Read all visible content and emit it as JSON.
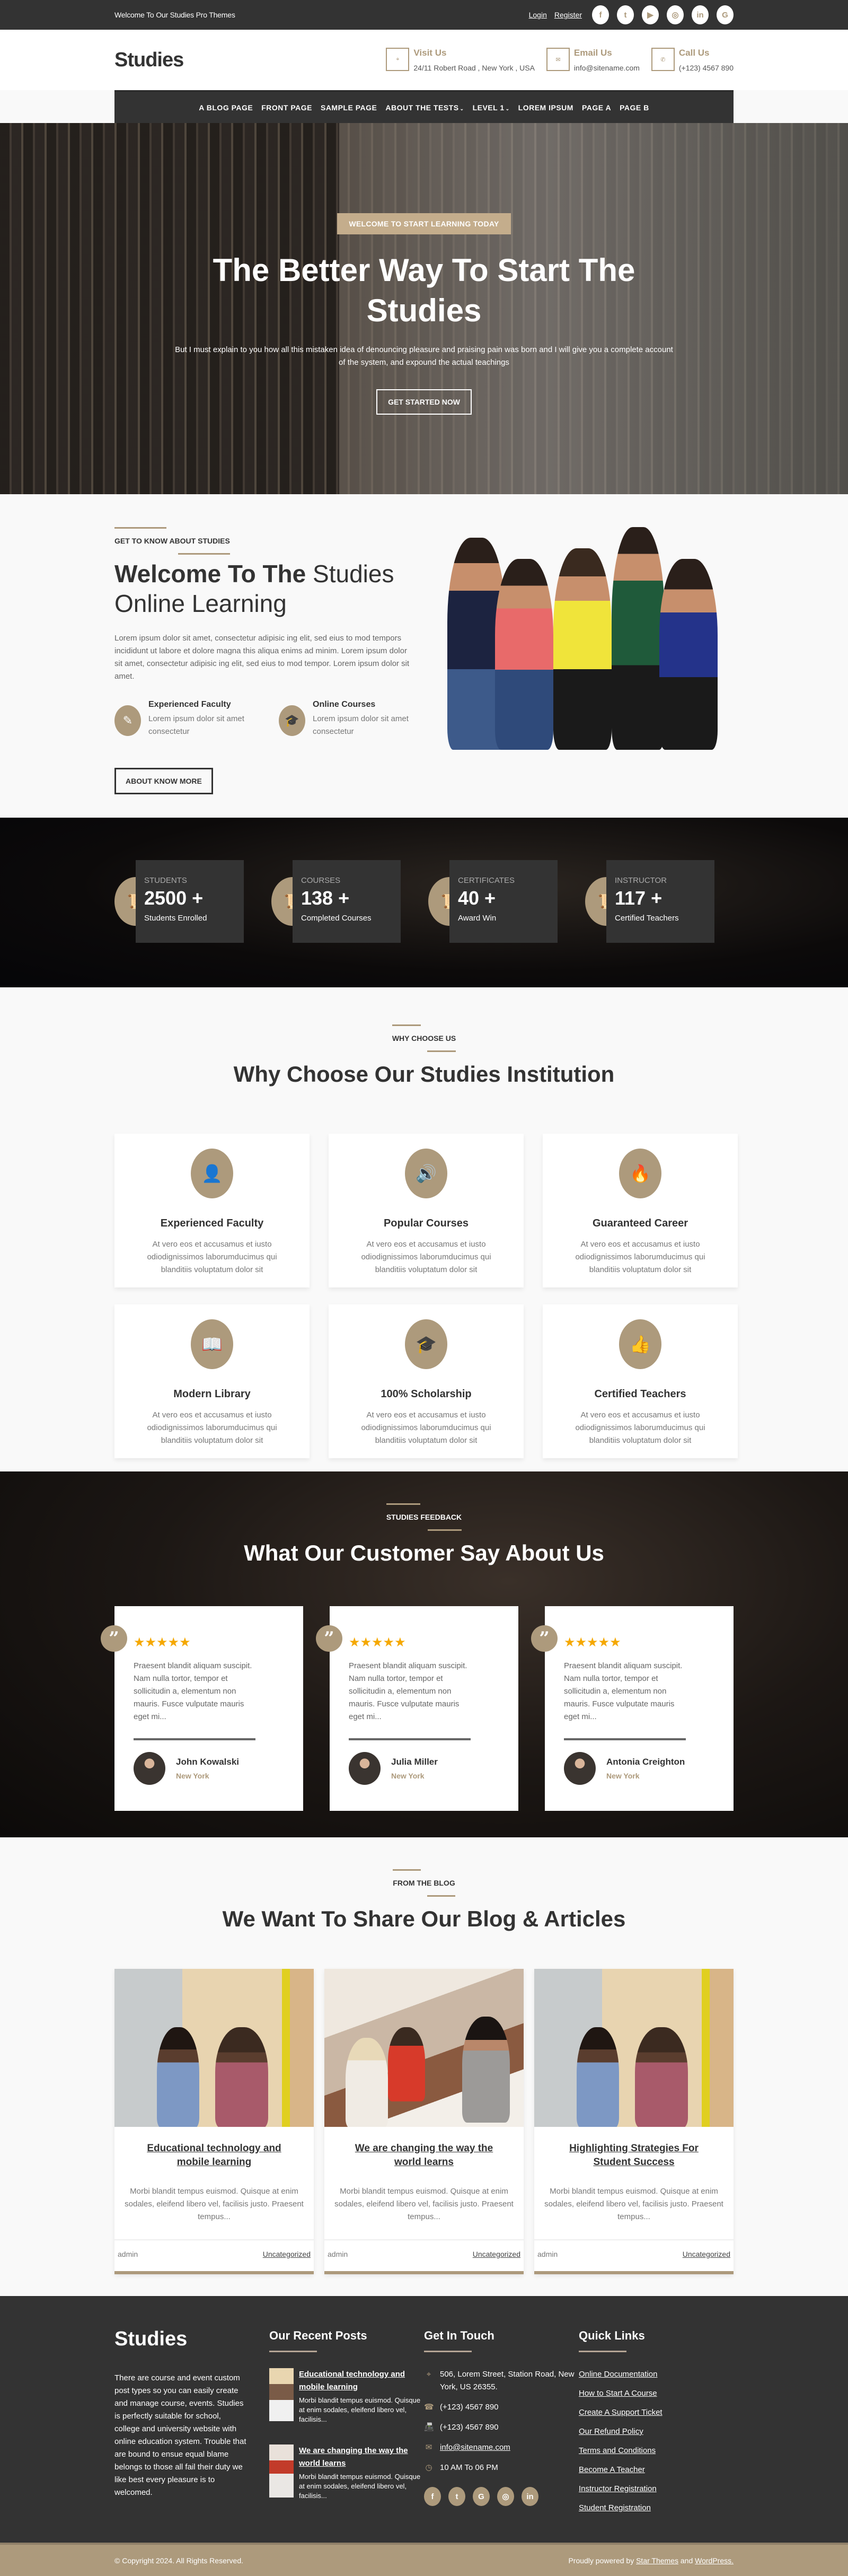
{
  "topbar": {
    "welcome": "Welcome To Our Studies Pro Themes",
    "login": "Login",
    "register": "Register",
    "social": [
      {
        "icon": "facebook-icon",
        "glyph": "f"
      },
      {
        "icon": "twitter-icon",
        "glyph": "t"
      },
      {
        "icon": "youtube-icon",
        "glyph": "▶"
      },
      {
        "icon": "instagram-icon",
        "glyph": "◎"
      },
      {
        "icon": "linkedin-icon",
        "glyph": "in"
      },
      {
        "icon": "google-icon",
        "glyph": "G"
      }
    ]
  },
  "header": {
    "logo": "Studies",
    "contacts": [
      {
        "icon": "map-pin-icon",
        "glyph": "⌖",
        "title": "Visit Us",
        "value": "24/11 Robert Road , New York , USA"
      },
      {
        "icon": "envelope-icon",
        "glyph": "✉",
        "title": "Email Us",
        "value": "info@sitename.com"
      },
      {
        "icon": "phone-icon",
        "glyph": "✆",
        "title": "Call Us",
        "value": "(+123) 4567 890"
      }
    ]
  },
  "nav": {
    "items": [
      {
        "label": "A BLOG PAGE",
        "dropdown": false
      },
      {
        "label": "FRONT PAGE",
        "dropdown": false
      },
      {
        "label": "SAMPLE PAGE",
        "dropdown": false
      },
      {
        "label": "ABOUT THE TESTS",
        "dropdown": true
      },
      {
        "label": "LEVEL 1",
        "dropdown": true
      },
      {
        "label": "LOREM IPSUM",
        "dropdown": false
      },
      {
        "label": "PAGE A",
        "dropdown": false
      },
      {
        "label": "PAGE B",
        "dropdown": false
      }
    ]
  },
  "hero": {
    "badge": "WELCOME TO START LEARNING TODAY",
    "title": "The Better Way To Start The Studies",
    "text": "But I must explain to you how all this mistaken idea of denouncing pleasure and praising pain was born and I will give you a complete account of the system, and expound the actual teachings",
    "button": "GET STARTED NOW"
  },
  "about": {
    "eyebrow": "GET TO KNOW ABOUT STUDIES",
    "title_bold": "Welcome To The",
    "title_rest": "Studies Online Learning",
    "description": "Lorem ipsum dolor sit amet, consectetur adipisic ing elit, sed eius to mod tempors incididunt ut labore et dolore magna this aliqua enims ad minim. Lorem ipsum dolor sit amet, consectetur adipisic ing elit, sed eius to mod tempor. Lorem ipsum dolor sit amet.",
    "features": [
      {
        "icon": "pencil-icon",
        "glyph": "✎",
        "title": "Experienced Faculty",
        "text": "Lorem ipsum dolor sit amet consectetur"
      },
      {
        "icon": "graduation-cap-icon",
        "glyph": "🎓",
        "title": "Online Courses",
        "text": "Lorem ipsum dolor sit amet consectetur"
      }
    ],
    "button": "ABOUT KNOW MORE"
  },
  "stats": [
    {
      "icon": "certificate-icon",
      "label": "STUDENTS",
      "value": "2500 +",
      "desc": "Students Enrolled"
    },
    {
      "icon": "certificate-icon",
      "label": "COURSES",
      "value": "138 +",
      "desc": "Completed Courses"
    },
    {
      "icon": "certificate-icon",
      "label": "CERTIFICATES",
      "value": "40 +",
      "desc": "Award Win"
    },
    {
      "icon": "certificate-icon",
      "label": "INSTRUCTOR",
      "value": "117 +",
      "desc": "Certified Teachers"
    }
  ],
  "why": {
    "eyebrow": "WHY CHOOSE US",
    "title": "Why Choose Our Studies Institution",
    "cards": [
      {
        "icon": "user-icon",
        "glyph": "👤",
        "title": "Experienced Faculty",
        "text": "At vero eos et accusamus et iusto odiodignissimos laborumducimus qui blanditiis voluptatum dolor sit"
      },
      {
        "icon": "speaker-icon",
        "glyph": "🔊",
        "title": "Popular Courses",
        "text": "At vero eos et accusamus et iusto odiodignissimos laborumducimus qui blanditiis voluptatum dolor sit"
      },
      {
        "icon": "flame-icon",
        "glyph": "🔥",
        "title": "Guaranteed Career",
        "text": "At vero eos et accusamus et iusto odiodignissimos laborumducimus qui blanditiis voluptatum dolor sit"
      },
      {
        "icon": "reader-book-icon",
        "glyph": "📖",
        "title": "Modern Library",
        "text": "At vero eos et accusamus et iusto odiodignissimos laborumducimus qui blanditiis voluptatum dolor sit"
      },
      {
        "icon": "graduation-cap-icon",
        "glyph": "🎓",
        "title": "100% Scholarship",
        "text": "At vero eos et accusamus et iusto odiodignissimos laborumducimus qui blanditiis voluptatum dolor sit"
      },
      {
        "icon": "thumbs-up-icon",
        "glyph": "👍",
        "title": "Certified Teachers",
        "text": "At vero eos et accusamus et iusto odiodignissimos laborumducimus qui blanditiis voluptatum dolor sit"
      }
    ]
  },
  "feedback": {
    "eyebrow": "STUDIES FEEDBACK",
    "title": "What Our Customer Say About Us",
    "testimonials": [
      {
        "rating": 5,
        "stars": "★★★★★",
        "text": "Praesent blandit aliquam suscipit. Nam nulla tortor, tempor et sollicitudin a, elementum non mauris. Fusce vulputate mauris eget mi...",
        "name": "John Kowalski",
        "location": "New York"
      },
      {
        "rating": 5,
        "stars": "★★★★★",
        "text": "Praesent blandit aliquam suscipit. Nam nulla tortor, tempor et sollicitudin a, elementum non mauris. Fusce vulputate mauris eget mi...",
        "name": "Julia Miller",
        "location": "New York"
      },
      {
        "rating": 5,
        "stars": "★★★★★",
        "text": "Praesent blandit aliquam suscipit. Nam nulla tortor, tempor et sollicitudin a, elementum non mauris. Fusce vulputate mauris eget mi...",
        "name": "Antonia Creighton",
        "location": "New York"
      }
    ]
  },
  "blog": {
    "eyebrow": "FROM THE BLOG",
    "title": "We Want To Share Our Blog & Articles",
    "posts": [
      {
        "title": "Educational technology and mobile learning",
        "excerpt": "Morbi blandit tempus euismod. Quisque at enim sodales, eleifend libero vel, facilisis justo. Praesent tempus...",
        "author": "admin",
        "category": "Uncategorized"
      },
      {
        "title": "We are changing the way the world learns",
        "excerpt": "Morbi blandit tempus euismod. Quisque at enim sodales, eleifend libero vel, facilisis justo. Praesent tempus...",
        "author": "admin",
        "category": "Uncategorized"
      },
      {
        "title": "Highlighting Strategies For Student Success",
        "excerpt": "Morbi blandit tempus euismod. Quisque at enim sodales, eleifend libero vel, facilisis justo. Praesent tempus...",
        "author": "admin",
        "category": "Uncategorized"
      }
    ]
  },
  "footer": {
    "logo": "Studies",
    "about": "There are course and event custom post types so you can easily create and manage course, events. Studies is perfectly suitable for school, college and university website with online education system. Trouble that are bound to ensue equal blame belongs to those all fail their duty we like best every pleasure is to welcomed.",
    "recent_title": "Our Recent Posts",
    "recent": [
      {
        "title": "Educational technology and mobile learning",
        "excerpt": "Morbi blandit tempus euismod. Quisque at enim sodales, eleifend libero vel, facilisis..."
      },
      {
        "title": "We are changing the way the world learns",
        "excerpt": "Morbi blandit tempus euismod. Quisque at enim sodales, eleifend libero vel, facilisis..."
      }
    ],
    "contact_title": "Get In Touch",
    "contact": [
      {
        "icon": "map-pin-icon",
        "glyph": "⌖",
        "text": "506, Lorem Street, Station Road, New York, US 26355.",
        "link": false
      },
      {
        "icon": "telephone-icon",
        "glyph": "☎",
        "text": "(+123) 4567 890",
        "link": false
      },
      {
        "icon": "fax-icon",
        "glyph": "📠",
        "text": "(+123) 4567 890",
        "link": false
      },
      {
        "icon": "envelope-icon",
        "glyph": "✉",
        "text": "info@sitename.com",
        "link": true
      },
      {
        "icon": "clock-icon",
        "glyph": "◷",
        "text": "10 AM To 06 PM",
        "link": false
      }
    ],
    "social": [
      {
        "icon": "facebook-icon",
        "glyph": "f"
      },
      {
        "icon": "twitter-icon",
        "glyph": "t"
      },
      {
        "icon": "google-icon",
        "glyph": "G"
      },
      {
        "icon": "instagram-icon",
        "glyph": "◎"
      },
      {
        "icon": "linkedin-icon",
        "glyph": "in"
      }
    ],
    "links_title": "Quick Links",
    "links": [
      "Online Documentation",
      "How to Start A Course",
      "Create A Support Ticket",
      "Our Refund Policy",
      "Terms and Conditions",
      "Become A Teacher",
      "Instructor Registration",
      "Student Registration"
    ]
  },
  "copyright": {
    "text": "© Copyright 2024. All Rights Reserved.",
    "powered_prefix": "Proudly powered by",
    "powered_link1": "Star Themes",
    "powered_and": "and",
    "powered_link2": "WordPress."
  },
  "colors": {
    "accent": "#ad9a7c",
    "dark": "#333333",
    "star": "#f5a800"
  }
}
